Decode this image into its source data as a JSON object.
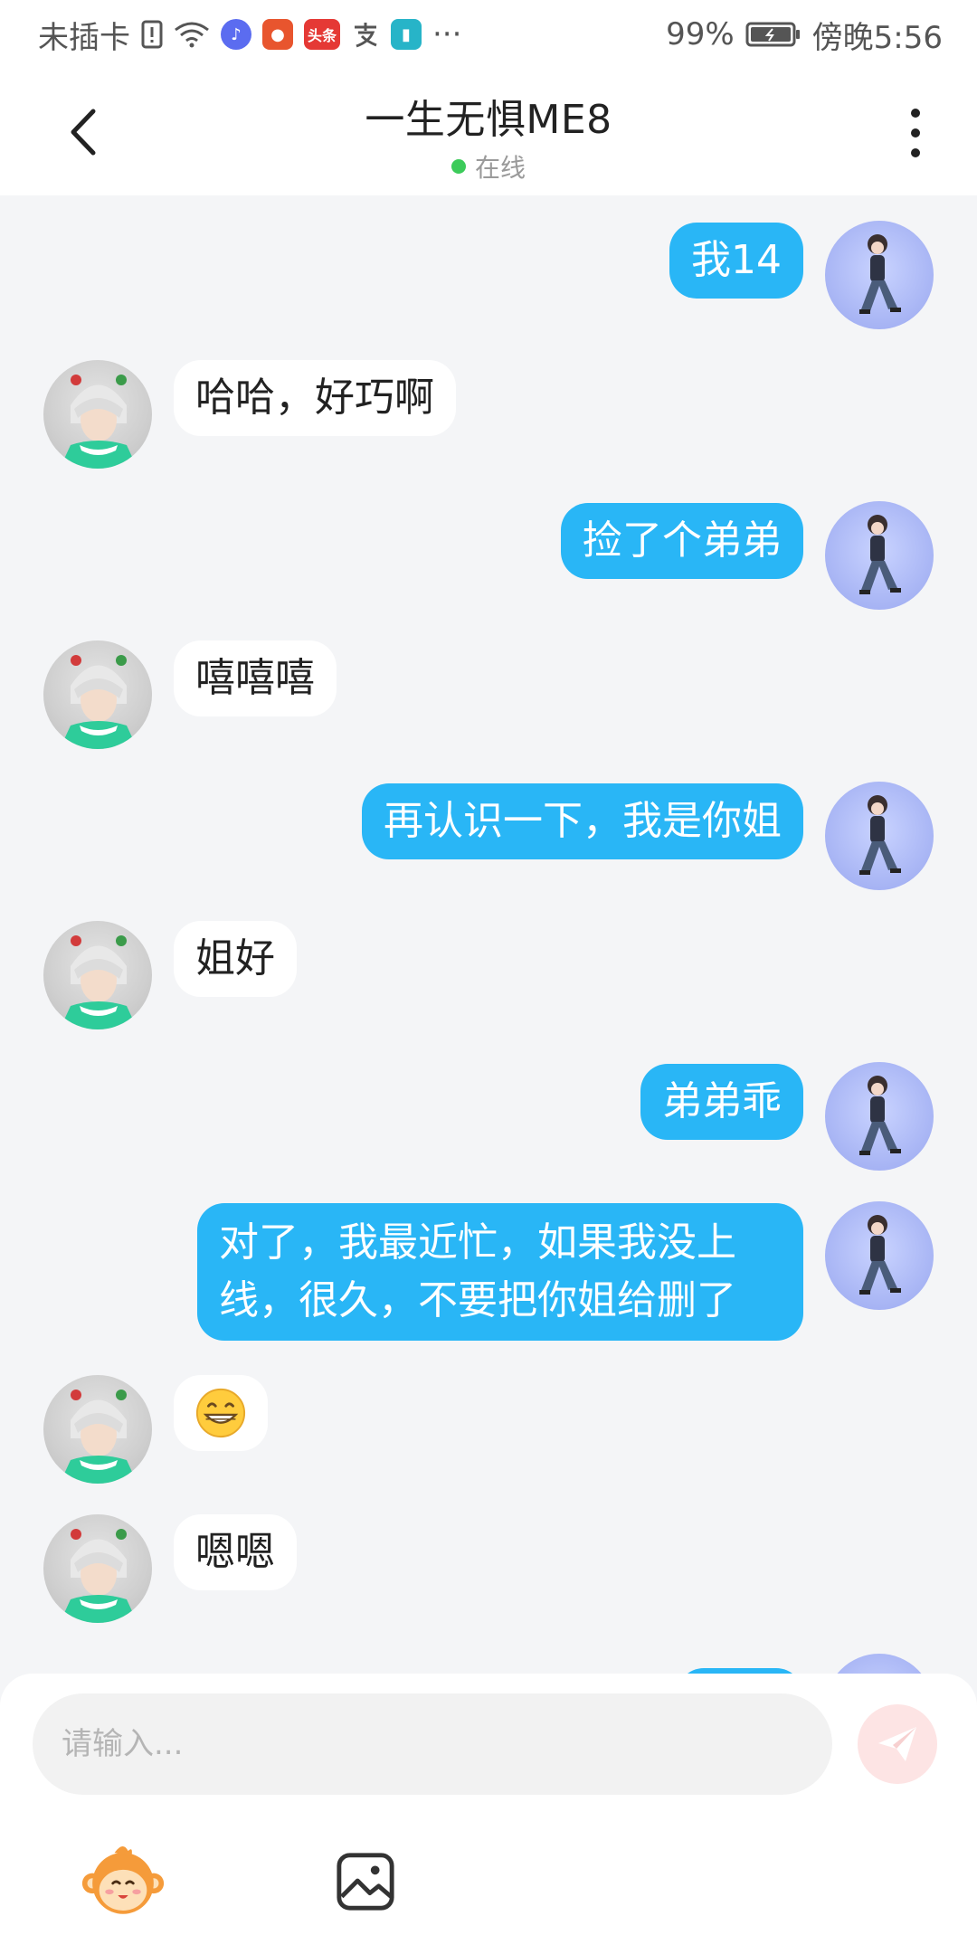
{
  "status_bar": {
    "carrier": "未插卡",
    "toutiao_label": "头条",
    "more": "···",
    "battery": "99%",
    "time": "傍晚5:56"
  },
  "header": {
    "title": "一生无惧ME8",
    "presence": "在线",
    "presence_color": "#3ccb5a"
  },
  "messages": [
    {
      "side": "me",
      "text": "我14"
    },
    {
      "side": "other",
      "text": "哈哈，好巧啊"
    },
    {
      "side": "me",
      "text": "捡了个弟弟"
    },
    {
      "side": "other",
      "text": "嘻嘻嘻"
    },
    {
      "side": "me",
      "text": "再认识一下，我是你姐"
    },
    {
      "side": "other",
      "text": "姐好"
    },
    {
      "side": "me",
      "text": "弟弟乖"
    },
    {
      "side": "me",
      "text": "对了，我最近忙，如果我没上线，很久，不要把你姐给删了"
    },
    {
      "side": "other",
      "text": "😁",
      "type": "emoji"
    },
    {
      "side": "other",
      "text": "嗯嗯"
    }
  ],
  "input": {
    "placeholder": "请输入..."
  },
  "toolbar": {
    "emoji_icon": "monkey-face-sticker-icon",
    "image_icon": "image-icon",
    "send_icon": "paper-plane-icon"
  },
  "colors": {
    "my_bubble": "#29b6f6",
    "other_bubble": "#ffffff",
    "background": "#f4f5f7",
    "send_button": "#fde4e4"
  }
}
